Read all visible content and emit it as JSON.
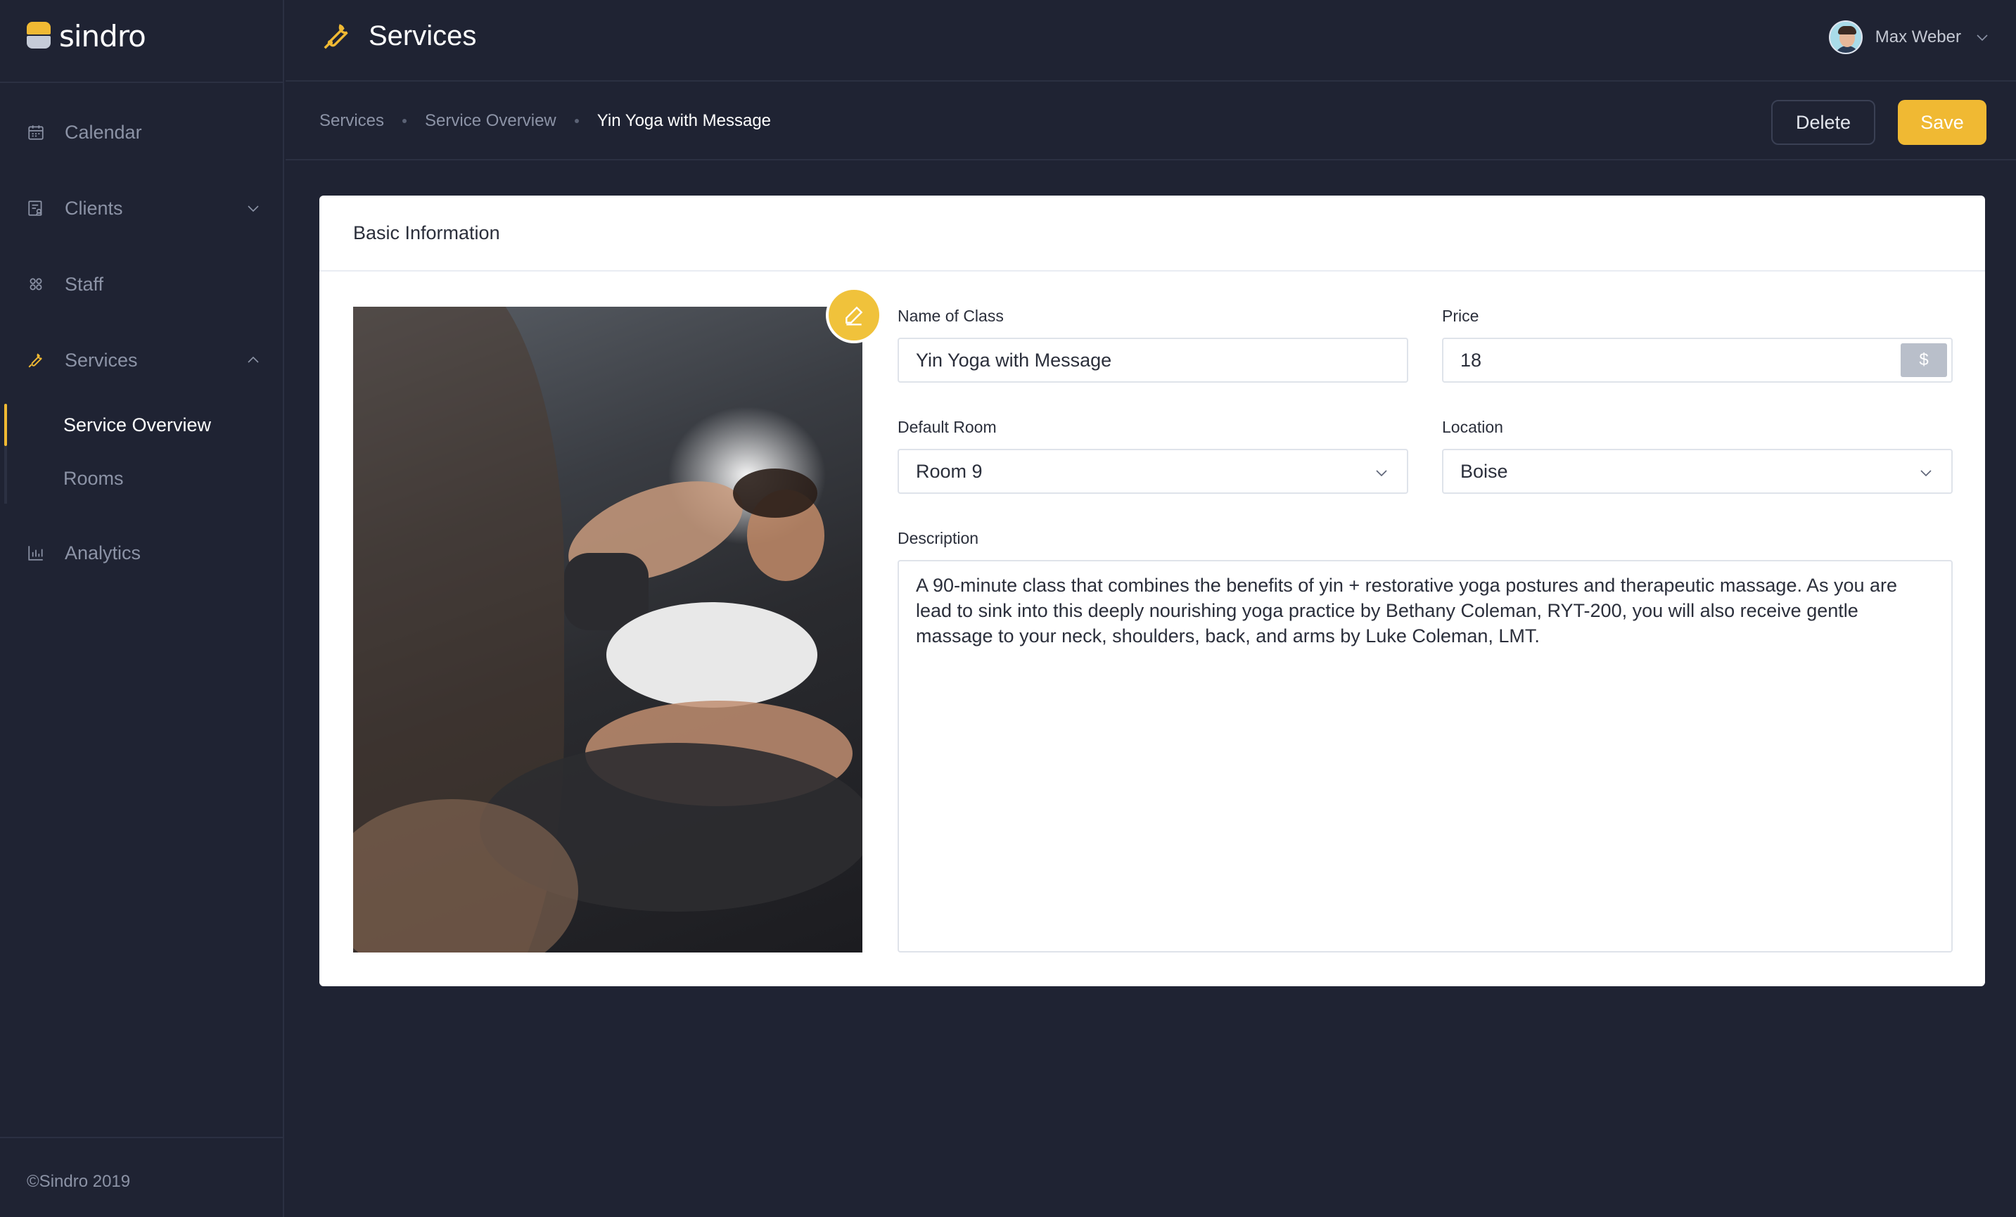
{
  "app": {
    "brand": "sindro"
  },
  "header": {
    "title": "Services",
    "user_name": "Max Weber"
  },
  "sidebar": {
    "items": [
      {
        "label": "Calendar"
      },
      {
        "label": "Clients"
      },
      {
        "label": "Staff"
      },
      {
        "label": "Services"
      },
      {
        "label": "Analytics"
      }
    ],
    "sub_items": [
      {
        "label": "Service Overview",
        "active": true
      },
      {
        "label": "Rooms",
        "active": false
      }
    ],
    "copyright": "©Sindro 2019"
  },
  "breadcrumb": [
    "Services",
    "Service Overview",
    "Yin Yoga with Message"
  ],
  "actions": {
    "delete_label": "Delete",
    "save_label": "Save"
  },
  "form": {
    "section_title": "Basic Information",
    "name_label": "Name of Class",
    "name_value": "Yin Yoga with Message",
    "price_label": "Price",
    "price_value": "18",
    "price_currency": "$",
    "room_label": "Default Room",
    "room_value": "Room 9",
    "location_label": "Location",
    "location_value": "Boise",
    "description_label": "Description",
    "description_value": "A 90-minute class that combines the benefits of yin + restorative yoga postures and therapeutic massage. As you are lead to sink into this deeply nourishing yoga practice by Bethany Coleman, RYT-200, you will also receive gentle massage to your neck, shoulders, back, and arms by Luke Coleman, LMT."
  },
  "colors": {
    "accent": "#f0b933",
    "background": "#1f2333",
    "card": "#ffffff"
  }
}
